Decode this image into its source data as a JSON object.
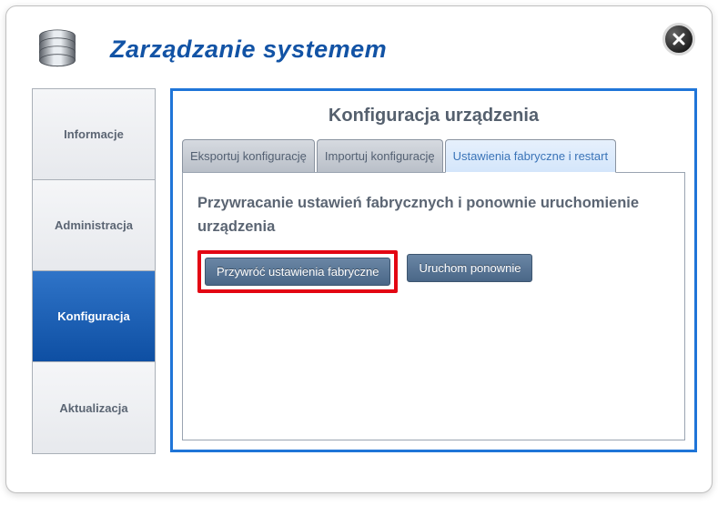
{
  "header": {
    "title": "Zarządzanie systemem"
  },
  "sidebar": {
    "items": [
      {
        "label": "Informacje",
        "active": false
      },
      {
        "label": "Administracja",
        "active": false
      },
      {
        "label": "Konfiguracja",
        "active": true
      },
      {
        "label": "Aktualizacja",
        "active": false
      }
    ]
  },
  "panel": {
    "title": "Konfiguracja urządzenia",
    "tabs": [
      {
        "label": "Eksportuj konfigurację",
        "active": false
      },
      {
        "label": "Importuj konfigurację",
        "active": false
      },
      {
        "label": "Ustawienia fabryczne i restart",
        "active": true
      }
    ],
    "section_title": "Przywracanie ustawień fabrycznych i ponownie uruchomienie urządzenia",
    "buttons": {
      "factory_reset": "Przywróć ustawienia fabryczne",
      "restart": "Uruchom ponownie"
    }
  }
}
